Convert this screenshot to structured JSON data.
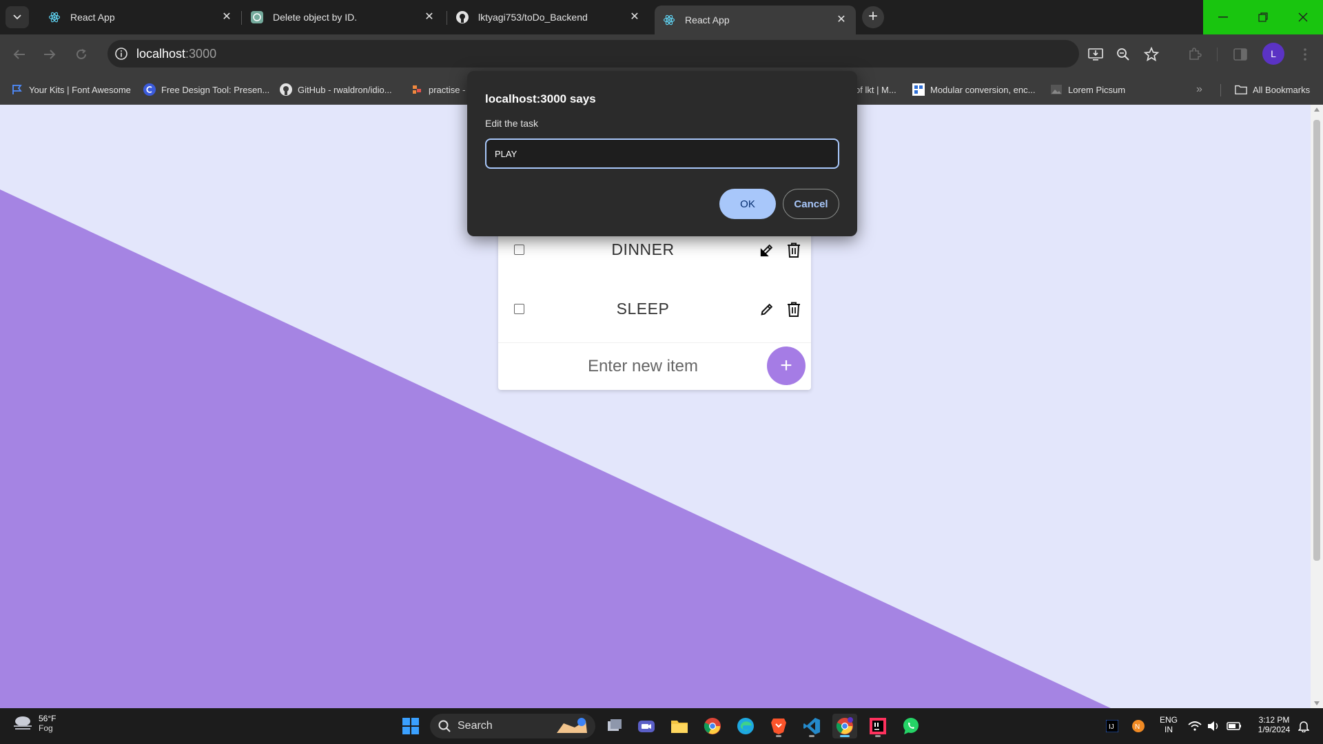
{
  "browser": {
    "tabs": [
      {
        "title": "React App",
        "icon": "react-icon"
      },
      {
        "title": "Delete object by ID.",
        "icon": "chatgpt-icon"
      },
      {
        "title": "lktyagi753/toDo_Backend",
        "icon": "github-icon"
      },
      {
        "title": "React App",
        "icon": "react-icon",
        "active": true
      }
    ],
    "url_host": "localhost",
    "url_port": ":3000",
    "profile_initial": "L",
    "bookmarks": [
      {
        "label": "Your Kits | Font Awesome",
        "icon": "flag-icon"
      },
      {
        "label": "Free Design Tool: Presen...",
        "icon": "canva-icon"
      },
      {
        "label": "GitHub - rwaldron/idio...",
        "icon": "github-icon"
      },
      {
        "label": "practise -",
        "icon": "bookmark-icon"
      },
      {
        "label": "of lkt | M...",
        "icon": "bookmark-icon"
      },
      {
        "label": "Modular conversion, enc...",
        "icon": "grid-icon"
      },
      {
        "label": "Lorem Picsum",
        "icon": "image-icon"
      }
    ],
    "all_bookmarks": "All Bookmarks"
  },
  "dialog": {
    "title": "localhost:3000 says",
    "message": "Edit the task",
    "value": "PLAY",
    "ok": "OK",
    "cancel": "Cancel"
  },
  "todo": {
    "items": [
      {
        "text": "DINNER",
        "done": false
      },
      {
        "text": "SLEEP",
        "done": false
      }
    ],
    "new_placeholder": "Enter new item",
    "add_label": "+"
  },
  "taskbar": {
    "weather_temp": "56°F",
    "weather_cond": "Fog",
    "search_label": "Search",
    "lang": "ENG",
    "region": "IN",
    "time": "3:12 PM",
    "date": "1/9/2024"
  },
  "colors": {
    "page_bg": "#e3e6fb",
    "purple": "#a584e3",
    "accent": "#a8c7fa"
  }
}
